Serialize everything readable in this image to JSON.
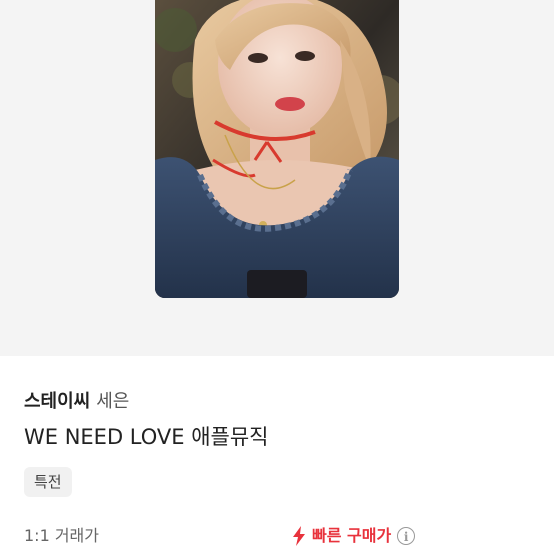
{
  "product": {
    "group_name": "스테이씨",
    "member_name": "세은",
    "title": "WE NEED LOVE 애플뮤직",
    "tag": "특전"
  },
  "trade": {
    "price_label": "1:1 거래가",
    "quick_buy_label": "빠른 구매가",
    "info_glyph": "i"
  },
  "icons": {
    "quick_buy": "lightning-bolt-icon",
    "info": "info-circle-icon"
  },
  "colors": {
    "accent": "#e8323c",
    "hero_background": "#f4f4f4"
  }
}
